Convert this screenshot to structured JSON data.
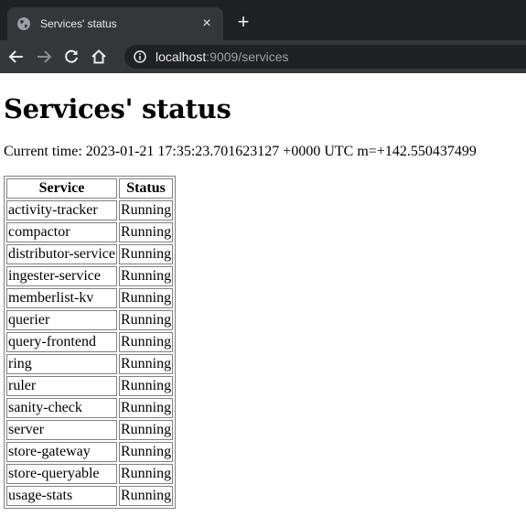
{
  "browser": {
    "tab_title": "Services' status",
    "tab_close": "×",
    "new_tab": "+",
    "url_host": "localhost",
    "url_rest": ":9009/services"
  },
  "page": {
    "heading": "Services' status",
    "current_time": "Current time: 2023-01-21 17:35:23.701623127 +0000 UTC m=+142.550437499"
  },
  "table": {
    "headers": [
      "Service",
      "Status"
    ],
    "rows": [
      [
        "activity-tracker",
        "Running"
      ],
      [
        "compactor",
        "Running"
      ],
      [
        "distributor-service",
        "Running"
      ],
      [
        "ingester-service",
        "Running"
      ],
      [
        "memberlist-kv",
        "Running"
      ],
      [
        "querier",
        "Running"
      ],
      [
        "query-frontend",
        "Running"
      ],
      [
        "ring",
        "Running"
      ],
      [
        "ruler",
        "Running"
      ],
      [
        "sanity-check",
        "Running"
      ],
      [
        "server",
        "Running"
      ],
      [
        "store-gateway",
        "Running"
      ],
      [
        "store-queryable",
        "Running"
      ],
      [
        "usage-stats",
        "Running"
      ]
    ]
  },
  "icons": {
    "favicon": "globe-icon",
    "back": "arrow-left-icon",
    "forward": "arrow-right-icon",
    "reload": "reload-icon",
    "home": "home-icon",
    "site_info": "info-icon"
  },
  "colors": {
    "tabbar_bg": "#202124",
    "toolbar_bg": "#35363a",
    "text_light": "#e8eaed",
    "text_dim": "#9aa0a6"
  }
}
